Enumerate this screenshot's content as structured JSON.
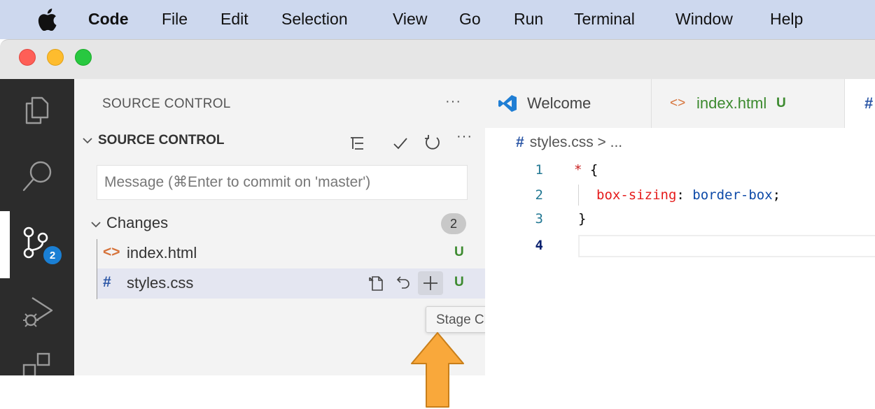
{
  "menubar": {
    "apple_icon": "apple-logo",
    "items": [
      "Code",
      "File",
      "Edit",
      "Selection",
      "View",
      "Go",
      "Run",
      "Terminal",
      "Window",
      "Help"
    ]
  },
  "window": {
    "traffic_lights": [
      "#fe5f57",
      "#febc2e",
      "#28c840"
    ]
  },
  "activity_bar": {
    "items": [
      "explorer-icon",
      "search-icon",
      "source-control-icon",
      "run-debug-icon",
      "extensions-icon"
    ],
    "source_control_badge": "2"
  },
  "sidebar": {
    "title": "SOURCE CONTROL",
    "more": "···",
    "section_title": "SOURCE CONTROL",
    "section_actions": [
      "view-as-tree-icon",
      "commit-check-icon",
      "refresh-icon",
      "more-icon"
    ],
    "section_more": "···",
    "commit_message_placeholder": "Message (⌘Enter to commit on 'master')",
    "changes_label": "Changes",
    "changes_count": "2",
    "files": [
      {
        "icon": "<>",
        "name": "index.html",
        "status": "U"
      },
      {
        "icon": "#",
        "name": "styles.css",
        "status": "U"
      }
    ],
    "row_actions": [
      "open-file-icon",
      "discard-changes-icon",
      "stage-changes-icon"
    ]
  },
  "tooltip": "Stage Changes",
  "editor": {
    "tabs": [
      {
        "label": "Welcome",
        "icon": "vscode-logo"
      },
      {
        "label": "index.html",
        "icon": "<>",
        "status": "U"
      },
      {
        "label": "#",
        "icon": "css-hash"
      }
    ],
    "breadcrumb_hash": "#",
    "breadcrumb": "styles.css > ...",
    "lines": [
      {
        "num": "1",
        "selector": "* ",
        "brace": "{"
      },
      {
        "num": "2",
        "property": "box-sizing",
        "colon": ": ",
        "value": "border-box",
        "semi": ";"
      },
      {
        "num": "3",
        "brace": "}"
      },
      {
        "num": "4"
      }
    ]
  },
  "colors": {
    "menubar_bg": "#cdd8ee",
    "activity_bg": "#2c2c2c",
    "badge": "#1a7fd4",
    "untracked": "#3c8a2f",
    "arrow": "#f9a83b"
  }
}
